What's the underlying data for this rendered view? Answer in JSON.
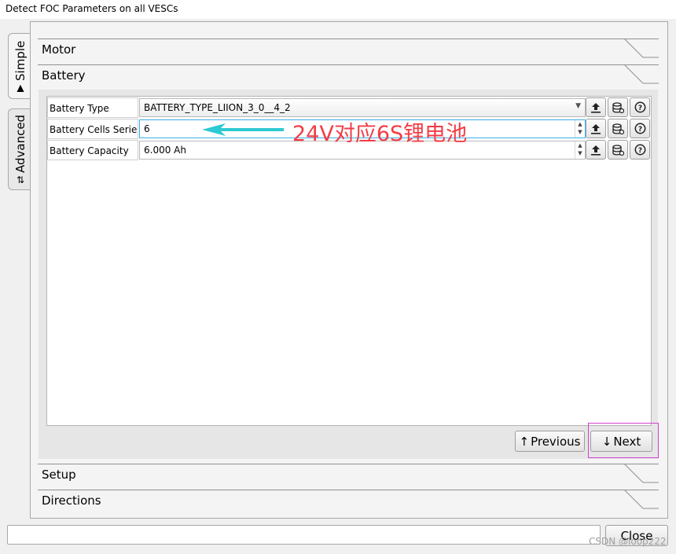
{
  "window": {
    "title": "Detect FOC Parameters on all VESCs"
  },
  "side_tabs": [
    {
      "label": "Simple",
      "icon": "simple-icon",
      "active": true
    },
    {
      "label": "Advanced",
      "icon": "sliders-icon",
      "active": false
    }
  ],
  "sections": {
    "motor": "Motor",
    "battery": "Battery",
    "setup": "Setup",
    "directions": "Directions"
  },
  "battery": {
    "params": [
      {
        "label": "Battery Type",
        "value": "BATTERY_TYPE_LIION_3_0__4_2",
        "kind": "combo"
      },
      {
        "label": "Battery Cells Series",
        "value": "6",
        "kind": "spin"
      },
      {
        "label": "Battery Capacity",
        "value": "6.000 Ah",
        "kind": "spin"
      }
    ],
    "row_buttons": [
      "upload-icon",
      "database-icon",
      "help-icon"
    ]
  },
  "annotation": {
    "text": "24V对应6S锂电池",
    "color": "#f23d45",
    "arrow_color": "#2ec9d3"
  },
  "nav": {
    "previous": "Previous",
    "next": "Next"
  },
  "footer": {
    "close": "Close",
    "status_value": ""
  },
  "watermark": "CSDN @loop222",
  "colors": {
    "focus": "#3daee9",
    "highlight": "#d23fd2"
  }
}
